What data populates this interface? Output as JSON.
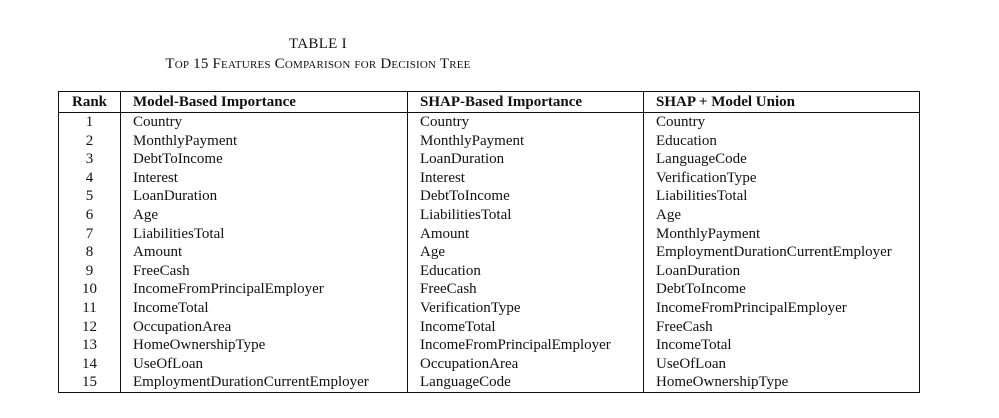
{
  "caption": {
    "label": "TABLE I",
    "title": "Top 15 Features Comparison for Decision Tree"
  },
  "table": {
    "headers": [
      "Rank",
      "Model-Based Importance",
      "SHAP-Based Importance",
      "SHAP + Model Union"
    ],
    "rows": [
      [
        "1",
        "Country",
        "Country",
        "Country"
      ],
      [
        "2",
        "MonthlyPayment",
        "MonthlyPayment",
        "Education"
      ],
      [
        "3",
        "DebtToIncome",
        "LoanDuration",
        "LanguageCode"
      ],
      [
        "4",
        "Interest",
        "Interest",
        "VerificationType"
      ],
      [
        "5",
        "LoanDuration",
        "DebtToIncome",
        "LiabilitiesTotal"
      ],
      [
        "6",
        "Age",
        "LiabilitiesTotal",
        "Age"
      ],
      [
        "7",
        "LiabilitiesTotal",
        "Amount",
        "MonthlyPayment"
      ],
      [
        "8",
        "Amount",
        "Age",
        "EmploymentDurationCurrentEmployer"
      ],
      [
        "9",
        "FreeCash",
        "Education",
        "LoanDuration"
      ],
      [
        "10",
        "IncomeFromPrincipalEmployer",
        "FreeCash",
        "DebtToIncome"
      ],
      [
        "11",
        "IncomeTotal",
        "VerificationType",
        "IncomeFromPrincipalEmployer"
      ],
      [
        "12",
        "OccupationArea",
        "IncomeTotal",
        "FreeCash"
      ],
      [
        "13",
        "HomeOwnershipType",
        "IncomeFromPrincipalEmployer",
        "IncomeTotal"
      ],
      [
        "14",
        "UseOfLoan",
        "OccupationArea",
        "UseOfLoan"
      ],
      [
        "15",
        "EmploymentDurationCurrentEmployer",
        "LanguageCode",
        "HomeOwnershipType"
      ]
    ]
  }
}
